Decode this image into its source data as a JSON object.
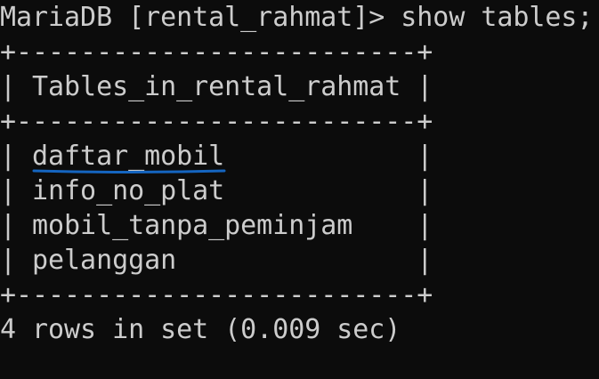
{
  "terminal": {
    "prompt": "MariaDB [rental_rahmat]> show tables;",
    "border_top": "+-------------------------+",
    "header_row": "| Tables_in_rental_rahmat |",
    "border_mid": "+-------------------------+",
    "rows": [
      "| daftar_mobil            |",
      "| info_no_plat            |",
      "| mobil_tanpa_peminjam    |",
      "| pelanggan               |"
    ],
    "border_bottom": "+-------------------------+",
    "summary": "4 rows in set (0.009 sec)"
  },
  "colors": {
    "background": "#0c0c0c",
    "text": "#cccccc",
    "annotation_underline": "#1565c0"
  }
}
